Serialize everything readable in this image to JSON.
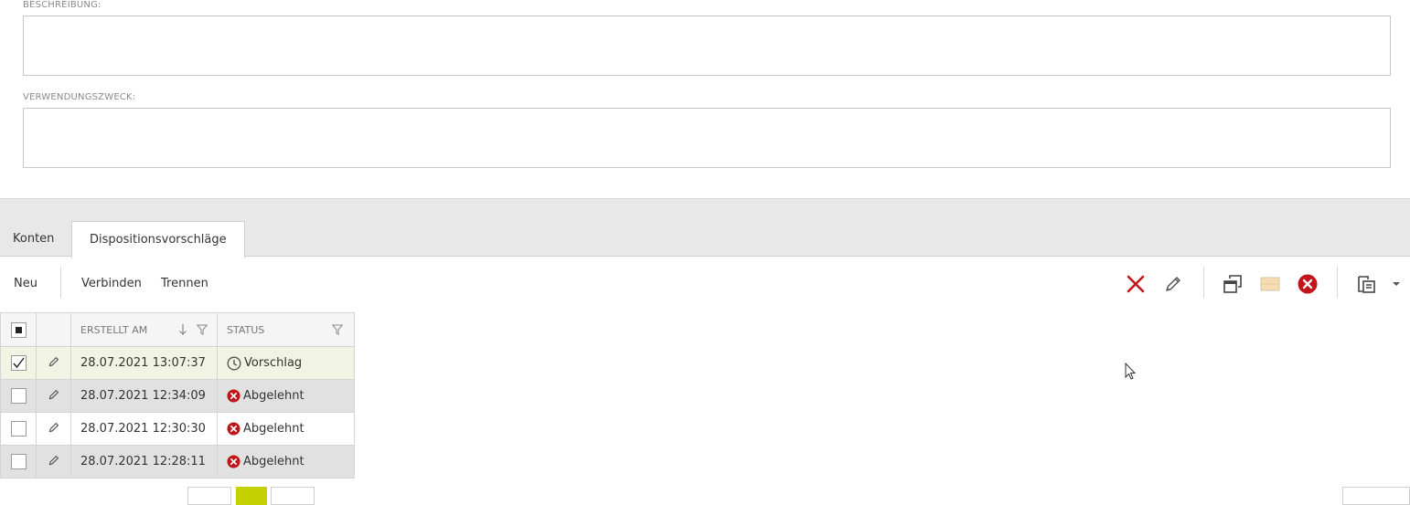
{
  "form": {
    "beschreibung_label": "BESCHREIBUNG:",
    "beschreibung_value": "",
    "verwendungszweck_label": "VERWENDUNGSZWECK:",
    "verwendungszweck_value": ""
  },
  "tabs": [
    {
      "label": "Konten",
      "active": false
    },
    {
      "label": "Dispositionsvorschläge",
      "active": true
    }
  ],
  "toolbar": {
    "new_label": "Neu",
    "connect_label": "Verbinden",
    "disconnect_label": "Trennen",
    "icons": [
      "delete-icon",
      "edit-icon",
      "open-window-icon",
      "image-icon",
      "cancel-icon",
      "paste-icon",
      "dropdown-arrow-icon"
    ]
  },
  "grid": {
    "columns": {
      "created": "ERSTELLT AM",
      "status": "STATUS"
    },
    "rows": [
      {
        "checked": true,
        "created": "28.07.2021 13:07:37",
        "status": "Vorschlag",
        "status_icon": "clock-icon"
      },
      {
        "checked": false,
        "created": "28.07.2021 12:34:09",
        "status": "Abgelehnt",
        "status_icon": "rejected-icon"
      },
      {
        "checked": false,
        "created": "28.07.2021 12:30:30",
        "status": "Abgelehnt",
        "status_icon": "rejected-icon"
      },
      {
        "checked": false,
        "created": "28.07.2021 12:28:11",
        "status": "Abgelehnt",
        "status_icon": "rejected-icon"
      }
    ]
  },
  "colors": {
    "accent": "#c5d000",
    "danger": "#c0151b",
    "selected_row": "#f1f4e2",
    "alt_row": "#e1e1e1"
  }
}
